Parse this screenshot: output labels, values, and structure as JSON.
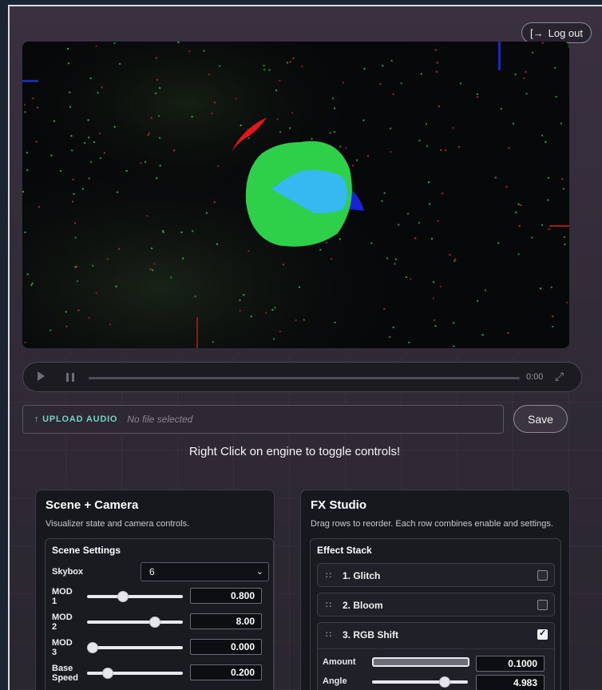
{
  "header": {
    "logout_label": "Log out",
    "logout_icon": "logout-icon"
  },
  "player": {
    "time": "0:00"
  },
  "upload": {
    "button_label": "↑ UPLOAD AUDIO",
    "file_status": "No file selected",
    "save_label": "Save"
  },
  "hint": "Right Click on engine to toggle controls!",
  "scene_panel": {
    "title": "Scene + Camera",
    "description": "Visualizer state and camera controls.",
    "section_title": "Scene Settings",
    "skybox": {
      "label": "Skybox",
      "value": "6"
    },
    "sliders": [
      {
        "label_line1": "MOD",
        "label_line2": "1",
        "value": "0.800",
        "fraction": 0.36
      },
      {
        "label_line1": "MOD",
        "label_line2": "2",
        "value": "8.00",
        "fraction": 0.74
      },
      {
        "label_line1": "MOD",
        "label_line2": "3",
        "value": "0.000",
        "fraction": 0.0
      },
      {
        "label_line1": "Base",
        "label_line2": "Speed",
        "value": "0.200",
        "fraction": 0.18
      }
    ]
  },
  "fx_panel": {
    "title": "FX Studio",
    "description": "Drag rows to reorder. Each row combines enable and settings.",
    "section_title": "Effect Stack",
    "effects": [
      {
        "label": "1. Glitch",
        "enabled": false
      },
      {
        "label": "2. Bloom",
        "enabled": false
      },
      {
        "label": "3. RGB Shift",
        "enabled": true
      }
    ],
    "rgb_params": [
      {
        "label": "Amount",
        "value": "0.1000",
        "fraction": 1.0
      },
      {
        "label": "Angle",
        "value": "4.983",
        "fraction": 0.79
      }
    ]
  },
  "colors": {
    "accent_teal": "#6fd3c8",
    "blob_green": "#2ed04a",
    "blob_cyan": "#36b8f0"
  }
}
